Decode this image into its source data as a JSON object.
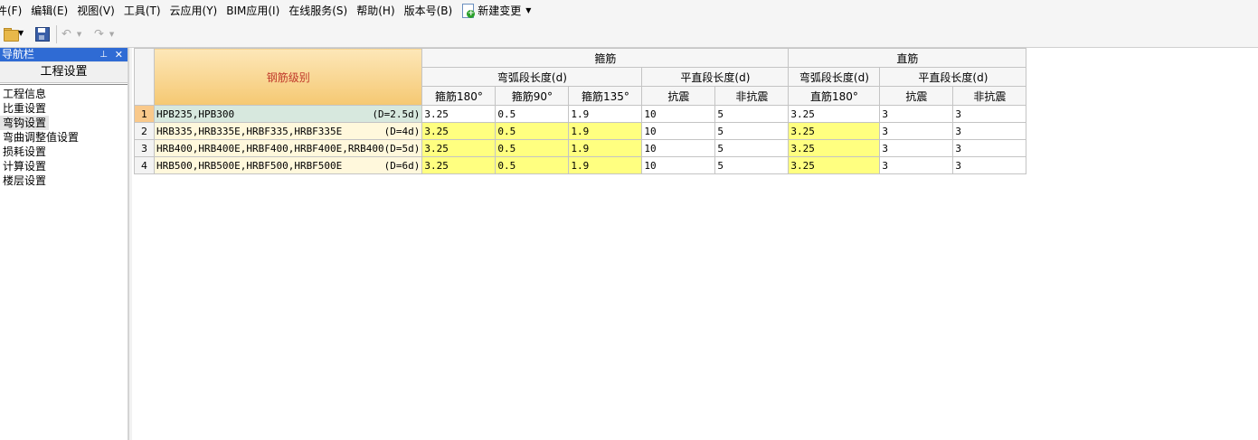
{
  "menu": {
    "items": [
      "件(F)",
      "编辑(E)",
      "视图(V)",
      "工具(T)",
      "云应用(Y)",
      "BIM应用(I)",
      "在线服务(S)",
      "帮助(H)",
      "版本号(B)"
    ],
    "new_change": "新建变更"
  },
  "toolbar": {
    "open": "folder-open-icon",
    "save": "save-icon",
    "undo": "undo-icon",
    "redo": "redo-icon"
  },
  "nav": {
    "title": "导航栏",
    "pin": "📌",
    "close": "✕",
    "header": "工程设置",
    "items": [
      "工程信息",
      "比重设置",
      "弯钩设置",
      "弯曲调整值设置",
      "损耗设置",
      "计算设置",
      "楼层设置"
    ],
    "selected_index": 2
  },
  "grid": {
    "grade_header": "钢筋级别",
    "group_stirrup": "箍筋",
    "group_straight": "直筋",
    "arc_len": "弯弧段长度(d)",
    "flat_len": "平直段长度(d)",
    "arc_len_2": "弯弧段长度(d)",
    "flat_len_2": "平直段长度(d)",
    "cols": [
      "箍筋180°",
      "箍筋90°",
      "箍筋135°",
      "抗震",
      "非抗震",
      "直筋180°",
      "抗震",
      "非抗震"
    ],
    "rows": [
      {
        "num": "1",
        "grade": "HPB235,HPB300",
        "d": "(D=2.5d)",
        "v": [
          "3.25",
          "0.5",
          "1.9",
          "10",
          "5",
          "3.25",
          "3",
          "3"
        ]
      },
      {
        "num": "2",
        "grade": "HRB335,HRB335E,HRBF335,HRBF335E",
        "d": "(D=4d)",
        "v": [
          "3.25",
          "0.5",
          "1.9",
          "10",
          "5",
          "3.25",
          "3",
          "3"
        ]
      },
      {
        "num": "3",
        "grade": "HRB400,HRB400E,HRBF400,HRBF400E,RRB400",
        "d": "(D=5d)",
        "v": [
          "3.25",
          "0.5",
          "1.9",
          "10",
          "5",
          "3.25",
          "3",
          "3"
        ]
      },
      {
        "num": "4",
        "grade": "HRB500,HRB500E,HRBF500,HRBF500E",
        "d": "(D=6d)",
        "v": [
          "3.25",
          "0.5",
          "1.9",
          "10",
          "5",
          "3.25",
          "3",
          "3"
        ]
      }
    ]
  }
}
